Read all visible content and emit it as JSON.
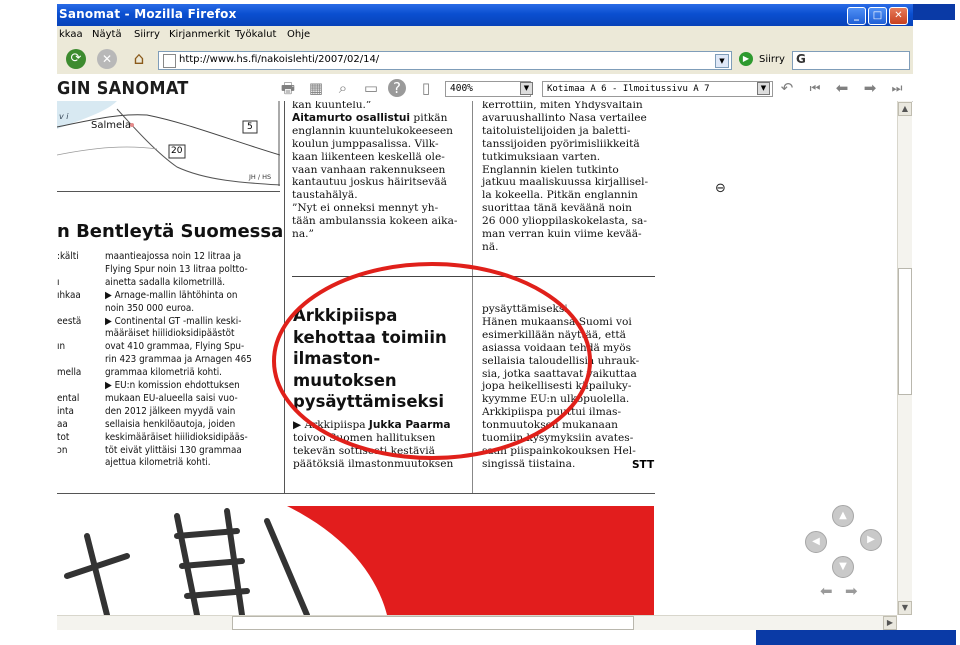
{
  "window": {
    "title": "Sanomat - Mozilla Firefox"
  },
  "menu": [
    "kkaa",
    "Näytä",
    "Siirry",
    "Kirjanmerkit",
    "Työkalut",
    "Ohje"
  ],
  "nav": {
    "url": "http://www.hs.fi/nakoislehti/2007/02/14/",
    "go_label": "Siirry",
    "search_placeholder": "G"
  },
  "viewer": {
    "logo": "GIN SANOMAT",
    "zoom": "400%",
    "section": "Kotimaa A 6 - Ilmoitussivu A 7"
  },
  "article_left": {
    "map_labels": [
      "Salmela",
      "5",
      "20",
      "JH / HS",
      "v i"
    ],
    "headline": "n Bentleytä Suomessa",
    "side_words": [
      ":kälti",
      "ı",
      "ıhkaa",
      "eestä",
      "ın",
      "mella",
      "ental",
      "inta",
      "aa",
      "tot",
      "ɔn"
    ],
    "lines": [
      "maantieajossa noin 12 litraa ja",
      "Flying Spur noin 13 litraa polttо-",
      "ainetta sadalla kilometrillä.",
      "▶ Arnage-mallin lähtöhinta on",
      "noin 350 000 euroa.",
      "▶ Continental GT -mallin keski-",
      "määräiset hiilidioksidipäästöt",
      "ovat 410 grammaa, Flying Spu-",
      "rin 423 grammaa ja Arnagen 465",
      "grammaa kilometriä kohti.",
      "▶ EU:n komission ehdottuksen",
      "mukaan EU-alueella saisi vuo-",
      "den 2012 jälkeen myydä vain",
      "sellaisia henkilöautoja, joiden",
      "keskimääräiset hiilidioksidipääs-",
      "töt eivät ylittäisi 130 grammaa",
      "ajettua kilometriä kohti."
    ]
  },
  "article_mid": {
    "lines_top": [
      "kan kuuntelu.”",
      "Aitamurto osallistui pitkän",
      "englannin kuuntelukokeeseen",
      "koulun jumppasalissa. Vilk-",
      "kaan liikenteen keskellä ole-",
      "vaan vanhaan rakennukseen",
      "kantautuu joskus häiritsevää",
      "taustahälyä.",
      "”Nyt ei onneksi mennyt yh-",
      "tään ambulanssia kokeen aika-",
      "na.”"
    ],
    "headline_lines": [
      "Arkkipiispa",
      "kehottaa toimiin",
      "ilmaston-",
      "muutoksen",
      "pysäyttämiseksi"
    ],
    "byline_prefix": "▶ Arkkipiispa ",
    "byline_name": "Jukka Paarma",
    "lines_bottom": [
      "toivoo Suomen hallituksen",
      "tekevän sottisesti kestäviä",
      "päätöksiä ilmastonmuutoksen"
    ]
  },
  "article_right": {
    "lines_top": [
      "kerrottiin, miten Yhdysvaltain",
      "avaruushallinto Nasa vertailee",
      "taitoluistelijoiden ja baletti-",
      "tanssijoiden pyörimisliikkeitä",
      "tutkimuksiaan varten.",
      "Englannin kielen tutkinto",
      "jatkuu maaliskuussa kirjallisel-",
      "la kokeella. Pitkän englannin",
      "suorittaa tänä keväänä noin",
      "26 000 ylioppilaskokelasta, sa-",
      "man verran kuin viime kevää-",
      "nä."
    ],
    "lines_bottom": [
      "pysäyttämiseksi.",
      "Hänen mukaansa Suomi voi",
      "esimerkillään näyttää, että",
      "asiassa voidaan tehdä myös",
      "sellaisia taloudellisia uhrauk-",
      "sia, jotka saattavat vaikuttaa",
      "jopa heikellisesti kilpailuky-",
      "kyymme EU:n ulkopuolella.",
      "Arkkipiispa puuttui ilmas-",
      "tonmuutoksen mukanaan",
      "tuomiin kysymyksiin avates-",
      "saan piispainkokouksen Hel-",
      "singissä tiistaina."
    ],
    "signature": "STT"
  },
  "colors": {
    "highlight_circle": "#e0201a",
    "ad_red": "#e21d1d",
    "titlebar_blue": "#0a4fd0"
  },
  "icons": [
    "print-icon",
    "page-view-icon",
    "zoom-icon",
    "two-page-icon",
    "help-icon",
    "download-icon",
    "undo-icon",
    "first-page-icon",
    "prev-page-icon",
    "next-page-icon",
    "last-page-icon",
    "zoom-out-cursor-icon"
  ]
}
